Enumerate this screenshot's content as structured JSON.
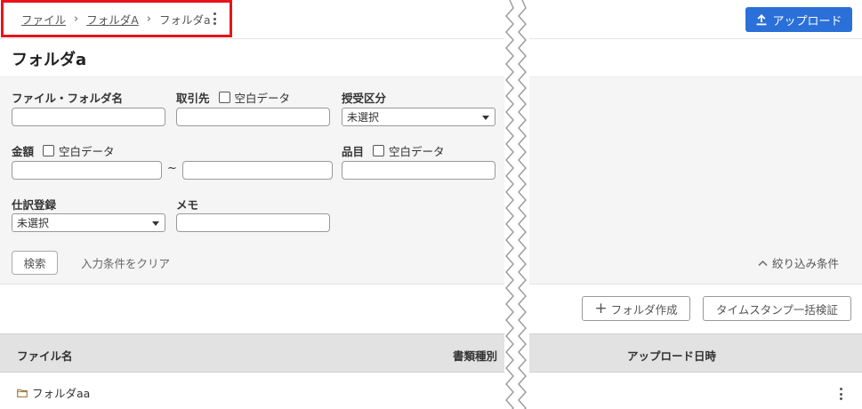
{
  "breadcrumb": {
    "items": [
      "ファイル",
      "フォルダA"
    ],
    "current": "フォルダa"
  },
  "header": {
    "upload_label": "アップロード"
  },
  "page": {
    "title": "フォルダa"
  },
  "filters": {
    "filename_label": "ファイル・フォルダ名",
    "partner_label": "取引先",
    "blank_data_label": "空白データ",
    "transfer_label": "授受区分",
    "transfer_value": "未選択",
    "amount_label": "金額",
    "amount_separator": "~",
    "item_label": "品目",
    "journal_label": "仕訳登録",
    "journal_value": "未選択",
    "memo_label": "メモ",
    "search_label": "検索",
    "clear_label": "入力条件をクリア",
    "collapse_label": "絞り込み条件"
  },
  "actions": {
    "create_folder_label": "フォルダ作成",
    "timestamp_label": "タイムスタンプ一括検証"
  },
  "table": {
    "columns": [
      "ファイル名",
      "書類種別",
      "アップロード日時"
    ],
    "rows": [
      {
        "name": "フォルダaa"
      }
    ]
  },
  "colors": {
    "accent": "#2a70d8",
    "highlight_box": "#e8141b",
    "header_bg": "#e2e2e2",
    "filter_bg": "#f5f5f5"
  }
}
